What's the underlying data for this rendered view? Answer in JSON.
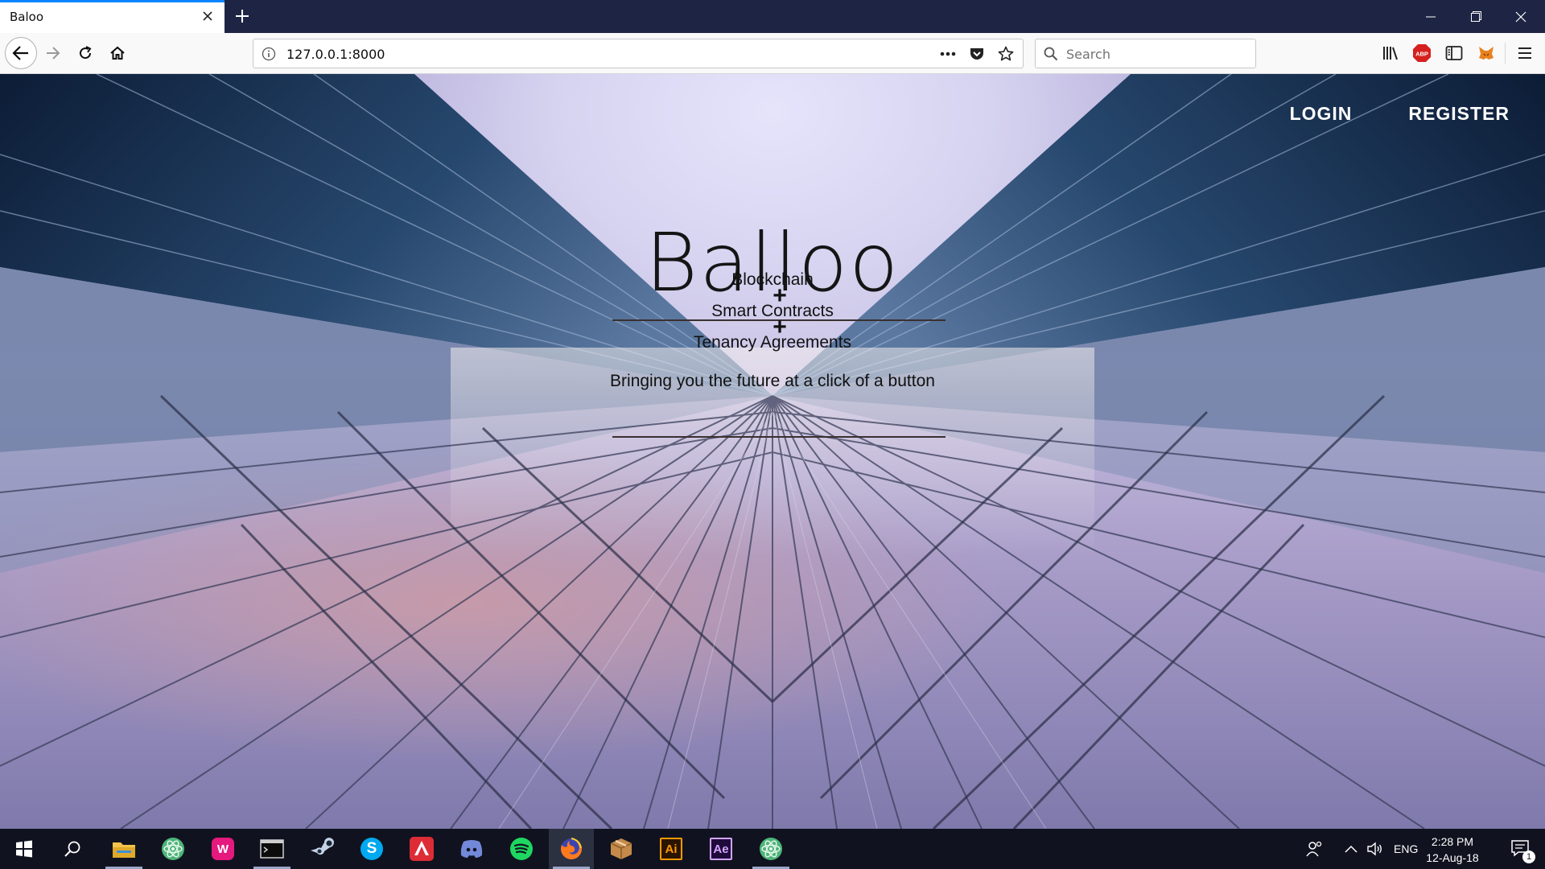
{
  "browser": {
    "tab": {
      "title": "Baloo"
    },
    "url": "127.0.0.1:8000",
    "search": {
      "placeholder": "Search"
    },
    "adblock_label": "ABP"
  },
  "site": {
    "nav": {
      "login": "LOGIN",
      "register": "REGISTER"
    },
    "hero": {
      "title": "Balloo",
      "lines": [
        "Blockchain",
        "Smart Contracts",
        "Tenancy Agreements"
      ],
      "plus": "+",
      "tagline": "Bringing you the future at a click of a button"
    }
  },
  "taskbar": {
    "apps": [
      {
        "name": "file-explorer",
        "label": ""
      },
      {
        "name": "atom",
        "label": ""
      },
      {
        "name": "wamp",
        "label": "W"
      },
      {
        "name": "terminal",
        "label": ""
      },
      {
        "name": "steam",
        "label": ""
      },
      {
        "name": "skype",
        "label": "S"
      },
      {
        "name": "angular",
        "label": ""
      },
      {
        "name": "discord",
        "label": ""
      },
      {
        "name": "spotify",
        "label": ""
      },
      {
        "name": "firefox",
        "label": ""
      },
      {
        "name": "package",
        "label": ""
      },
      {
        "name": "illustrator",
        "label": "Ai"
      },
      {
        "name": "after-effects",
        "label": "Ae"
      },
      {
        "name": "atom-2",
        "label": ""
      }
    ],
    "language": "ENG",
    "time": "2:28 PM",
    "date": "12-Aug-18",
    "notification_count": "1"
  }
}
